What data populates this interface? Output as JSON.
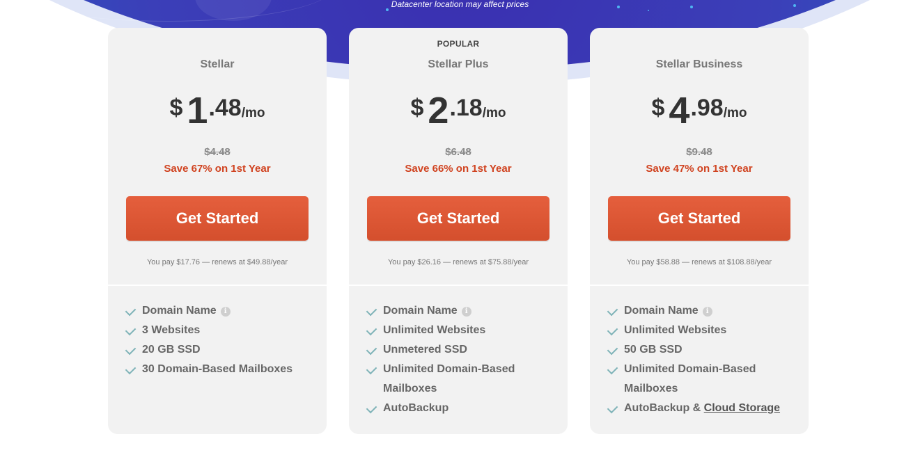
{
  "hero": {
    "note": "Datacenter location may affect prices"
  },
  "colors": {
    "accent_button": "#e05a36",
    "save_text": "#d0421f",
    "check_icon": "#7fb3b8"
  },
  "plans": [
    {
      "badge": "",
      "name": "Stellar",
      "currency": "$",
      "price_whole": "1",
      "price_fraction": ".48",
      "price_period": "/mo",
      "old_price": "$4.48",
      "save": "Save 67% on 1st Year",
      "cta": "Get Started",
      "renewal": "You pay $17.76 — renews at $49.88/year",
      "features": [
        {
          "text": "Domain Name"
        },
        {
          "text": "3 Websites"
        },
        {
          "text": "20 GB SSD"
        },
        {
          "text": "30 Domain-Based Mailboxes"
        }
      ]
    },
    {
      "badge": "POPULAR",
      "name": "Stellar Plus",
      "currency": "$",
      "price_whole": "2",
      "price_fraction": ".18",
      "price_period": "/mo",
      "old_price": "$6.48",
      "save": "Save 66% on 1st Year",
      "cta": "Get Started",
      "renewal": "You pay $26.16 — renews at $75.88/year",
      "features": [
        {
          "text": "Domain Name"
        },
        {
          "text": "Unlimited Websites"
        },
        {
          "text": "Unmetered SSD"
        },
        {
          "text": "Unlimited Domain-Based Mailboxes"
        },
        {
          "text": "AutoBackup"
        }
      ]
    },
    {
      "badge": "",
      "name": "Stellar Business",
      "currency": "$",
      "price_whole": "4",
      "price_fraction": ".98",
      "price_period": "/mo",
      "old_price": "$9.48",
      "save": "Save 47% on 1st Year",
      "cta": "Get Started",
      "renewal": "You pay $58.88 — renews at $108.88/year",
      "features": [
        {
          "text": "Domain Name"
        },
        {
          "text": "Unlimited Websites"
        },
        {
          "text": "50 GB SSD"
        },
        {
          "text": "Unlimited Domain-Based Mailboxes"
        },
        {
          "text": "AutoBackup & ",
          "link": "Cloud Storage"
        }
      ]
    }
  ]
}
